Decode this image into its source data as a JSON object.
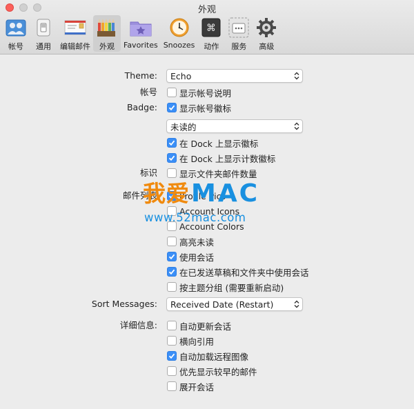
{
  "window": {
    "title": "外观"
  },
  "toolbar": {
    "tabs": [
      {
        "label": "帐号",
        "icon": "accounts-icon"
      },
      {
        "label": "通用",
        "icon": "general-switch-icon"
      },
      {
        "label": "编辑邮件",
        "icon": "envelope-icon"
      },
      {
        "label": "外观",
        "icon": "colored-pencils-icon",
        "active": true
      },
      {
        "label": "Favorites",
        "icon": "favorites-folder-icon"
      },
      {
        "label": "Snoozes",
        "icon": "snooze-clock-icon"
      },
      {
        "label": "动作",
        "icon": "command-key-icon"
      },
      {
        "label": "服务",
        "icon": "services-icon"
      },
      {
        "label": "高级",
        "icon": "gear-icon"
      }
    ]
  },
  "form": {
    "theme_label": "Theme:",
    "theme_value": "Echo",
    "account_label": "帐号",
    "show_account_desc": "显示帐号说明",
    "badge_label": "Badge:",
    "show_account_badge": "显示帐号徽标",
    "badge_select_value": "未读的",
    "dock_badge": "在 Dock 上显示徽标",
    "dock_count_badge": "在 Dock 上显示计数徽标",
    "flags_label": "标识",
    "show_folder_count": "显示文件夹邮件数量",
    "maillist_label": "邮件列表",
    "profile_pics": "Profile Pics",
    "account_icons": "Account Icons",
    "account_colors": "Account Colors",
    "highlight_unread": "高亮未读",
    "use_threads": "使用会话",
    "threads_in_sent": "在已发送草稿和文件夹中使用会话",
    "group_by_subject": "按主题分组 (需要重新启动)",
    "sort_label": "Sort Messages:",
    "sort_value": "Received Date (Restart)",
    "details_label": "详细信息:",
    "auto_update_threads": "自动更新会话",
    "horizontal_quote": "横向引用",
    "auto_load_images": "自动加载远程图像",
    "earlier_first": "优先显示较早的邮件",
    "expand_threads": "展开会话"
  },
  "checkbox_states": {
    "show_account_desc": false,
    "show_account_badge": true,
    "dock_badge": true,
    "dock_count_badge": true,
    "show_folder_count": false,
    "profile_pics": true,
    "account_icons": false,
    "account_colors": false,
    "highlight_unread": false,
    "use_threads": true,
    "threads_in_sent": true,
    "group_by_subject": false,
    "auto_update_threads": false,
    "horizontal_quote": false,
    "auto_load_images": true,
    "earlier_first": false,
    "expand_threads": false
  },
  "watermark": {
    "cn": "我爱",
    "en": "MAC",
    "url": "www.52mac.com"
  },
  "colors": {
    "accent": "#3b8ff7",
    "watermark_orange": "#f08a0e",
    "watermark_blue": "#1990e0"
  }
}
